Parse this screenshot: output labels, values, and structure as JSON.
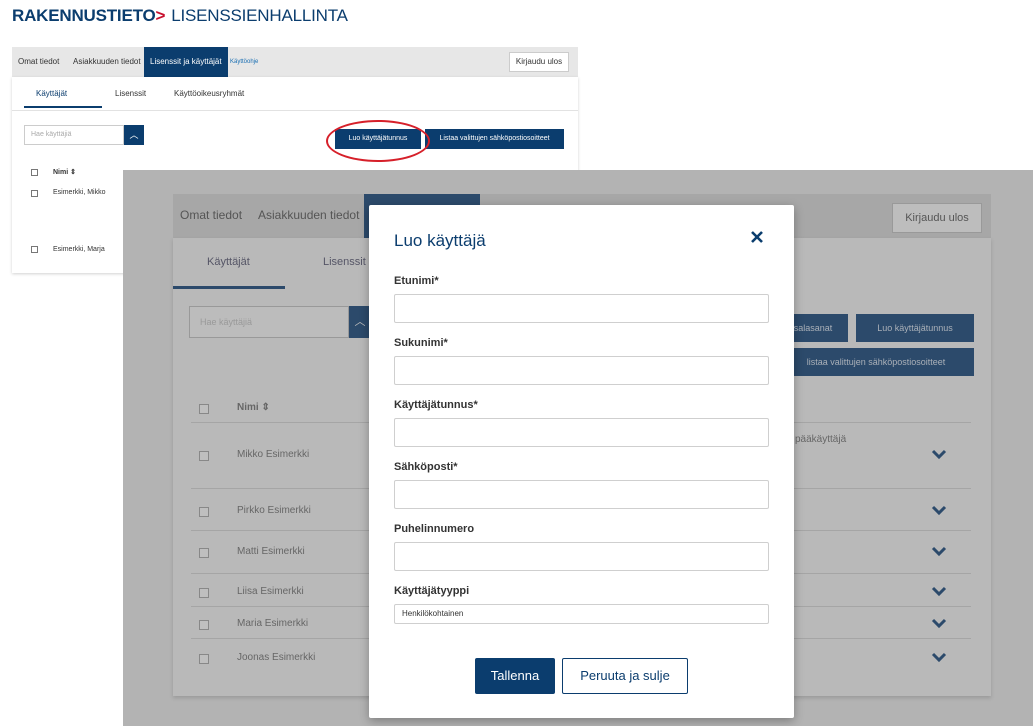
{
  "brand": {
    "primary": "RAKENNUSTIETO",
    "chevron": ">",
    "secondary": "LISENSSIENHALLINTA"
  },
  "top": {
    "nav": {
      "tab1": "Omat tiedot",
      "tab2": "Asiakkuuden tiedot",
      "tab3": "Lisenssit ja käyttäjät",
      "help": "Käyttöohje",
      "logout": "Kirjaudu ulos"
    },
    "subtabs": {
      "users": "Käyttäjät",
      "licenses": "Lisenssit",
      "rights": "Käyttöoikeusryhmät"
    },
    "search_placeholder": "Hae käyttäjiä",
    "buttons": {
      "create": "Luo käyttäjätunnus",
      "list_emails": "Listaa valittujen sähköpostiosoitteet"
    },
    "table": {
      "name_header": "Nimi ⇕",
      "rows": [
        "Esimerkki, Mikko",
        "Esimerkki, Marja"
      ]
    }
  },
  "big": {
    "nav": {
      "tab1": "Omat tiedot",
      "tab2": "Asiakkuuden tiedot",
      "logout": "Kirjaudu ulos"
    },
    "subtabs": {
      "users": "Käyttäjät",
      "licenses": "Lisenssit"
    },
    "search_placeholder": "Hae käyttäjiä",
    "buttons": {
      "passwords": "salasanat",
      "create": "Luo käyttäjätunnus",
      "list_emails": "listaa valittujen sähköpostiosoitteet"
    },
    "table": {
      "name_header": "Nimi ⇕",
      "admin_note": "pääkäyttäjä",
      "rows": [
        "Mikko Esimerkki",
        "Pirkko Esimerkki",
        "Matti Esimerkki",
        "Liisa Esimerkki",
        "Maria Esimerkki",
        "Joonas Esimerkki"
      ]
    }
  },
  "modal": {
    "title": "Luo käyttäjä",
    "fields": {
      "firstname": "Etunimi*",
      "lastname": "Sukunimi*",
      "username": "Käyttäjätunnus*",
      "email": "Sähköposti*",
      "phone": "Puhelinnumero",
      "usertype": "Käyttäjätyyppi"
    },
    "usertype_value": "Henkilökohtainen",
    "save": "Tallenna",
    "cancel": "Peruuta ja sulje"
  },
  "colors": {
    "brand_blue": "#0b3d6e",
    "brand_red": "#c8102e",
    "highlight_red": "#d6202a"
  },
  "icons": {
    "close": "close-icon",
    "chevron_up": "chevron-up-icon",
    "chevron_down": "chevron-down-icon",
    "sort": "sort-icon"
  }
}
